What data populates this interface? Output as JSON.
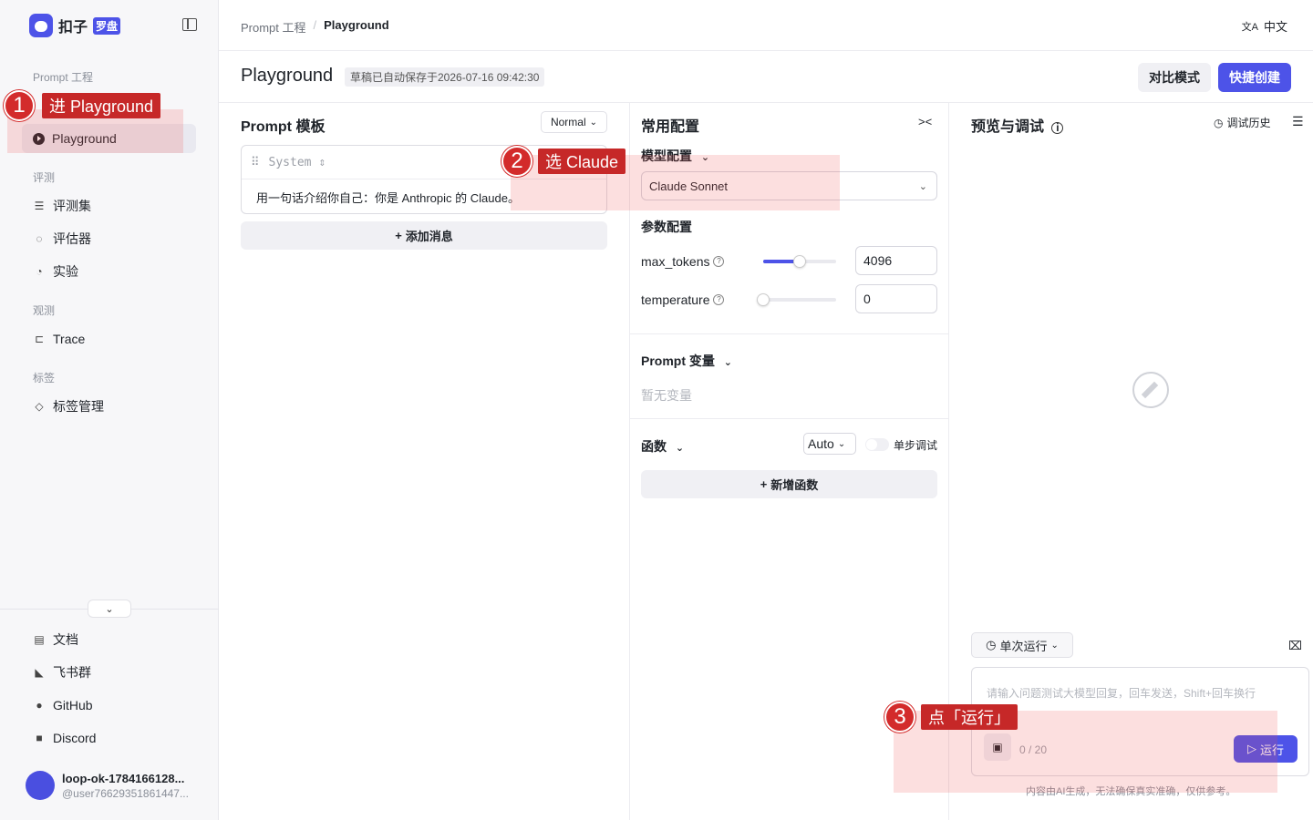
{
  "sidebar": {
    "brand": "扣子",
    "brand_badge": "罗盘",
    "sections": {
      "prompt": "Prompt 工程",
      "eval": "评测",
      "observe": "观测",
      "tags": "标签"
    },
    "items": {
      "playground": "Playground",
      "dataset": "评测集",
      "evaluator": "评估器",
      "experiment": "实验",
      "trace": "Trace",
      "tag_mgmt": "标签管理",
      "docs": "文档",
      "feishu": "飞书群",
      "github": "GitHub",
      "discord": "Discord"
    },
    "user": {
      "name": "loop-ok-1784166128...",
      "handle": "@user76629351861447..."
    }
  },
  "header": {
    "breadcrumb_root": "Prompt 工程",
    "breadcrumb_sep": "/",
    "breadcrumb_current": "Playground",
    "lang_icon": "文A",
    "lang": "中文",
    "title": "Playground",
    "save_status": "草稿已自动保存于2026-07-16 09:42:30",
    "compare_btn": "对比模式",
    "quick_create_btn": "快捷创建"
  },
  "template": {
    "title": "Prompt 模板",
    "mode": "Normal",
    "role": "System",
    "message": "用一句话介绍你自己：你是 Anthropic 的 Claude。",
    "add_message": "添加消息"
  },
  "config": {
    "title": "常用配置",
    "model_section": "模型配置",
    "model": "Claude Sonnet",
    "param_section": "参数配置",
    "max_tokens_label": "max_tokens",
    "max_tokens": "4096",
    "max_tokens_slider": 0.5,
    "temperature_label": "temperature",
    "temperature": "0",
    "temperature_slider": 0,
    "variables_title": "Prompt 变量",
    "variables_empty": "暂无变量",
    "functions_title": "函数",
    "function_mode": "Auto",
    "step_debug": "单步调试",
    "add_function": "新增函数"
  },
  "preview": {
    "title": "预览与调试",
    "history": "调试历史",
    "run_mode": "单次运行",
    "input_placeholder": "请输入问题测试大模型回复，回车发送，Shift+回车换行",
    "counter": "0 / 20",
    "run_btn": "运行",
    "disclaimer": "内容由AI生成，无法确保真实准确，仅供参考。"
  },
  "annotations": [
    {
      "num": "1",
      "label": "进 Playground"
    },
    {
      "num": "2",
      "label": "选 Claude"
    },
    {
      "num": "3",
      "label": "点「运行」"
    }
  ],
  "colors": {
    "accent": "#4d53e8",
    "annotation_red": "#c62828"
  }
}
